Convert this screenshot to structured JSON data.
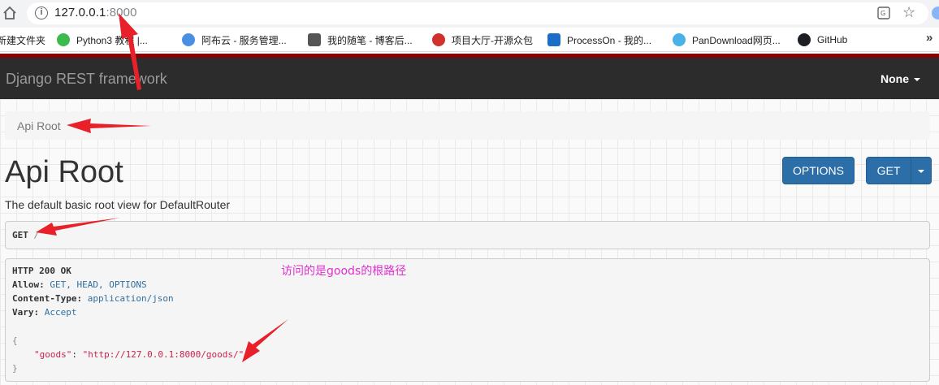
{
  "browser": {
    "url_host": "127.0.0.1",
    "url_port": ":8000",
    "bookmarks": [
      {
        "label": "新建文件夹",
        "color": "#f4b400"
      },
      {
        "label": "Python3 教程 |...",
        "color": "#3dba4e"
      },
      {
        "label": "阿布云 - 服务管理...",
        "color": "#4a90e2"
      },
      {
        "label": "我的随笔 - 博客后...",
        "color": "#555555"
      },
      {
        "label": "项目大厅-开源众包",
        "color": "#d0312d"
      },
      {
        "label": "ProcessOn - 我的...",
        "color": "#1a6ec8"
      },
      {
        "label": "PanDownload网页...",
        "color": "#4ab0e8"
      },
      {
        "label": "GitHub",
        "color": "#1b1f23"
      }
    ],
    "more_label": "»"
  },
  "navbar": {
    "brand": "Django REST framework",
    "user": "None"
  },
  "breadcrumb": {
    "item": "Api Root"
  },
  "content": {
    "title": "Api Root",
    "options_button": "OPTIONS",
    "get_button": "GET",
    "description": "The default basic root view for DefaultRouter",
    "request_method": "GET",
    "request_path": "/",
    "response": {
      "status_line": "HTTP 200 OK",
      "allow_key": "Allow:",
      "allow_value": "GET, HEAD, OPTIONS",
      "content_type_key": "Content-Type:",
      "content_type_value": "application/json",
      "vary_key": "Vary:",
      "vary_value": "Accept",
      "open_brace": "{",
      "goods_key": "\"goods\"",
      "goods_sep": ": ",
      "goods_value": "\"http://127.0.0.1:8000/goods/\"",
      "close_brace": "}"
    }
  },
  "annotation": {
    "text": "访问的是goods的根路径",
    "color": "#e02fd0",
    "arrow_color": "#e8202a"
  }
}
